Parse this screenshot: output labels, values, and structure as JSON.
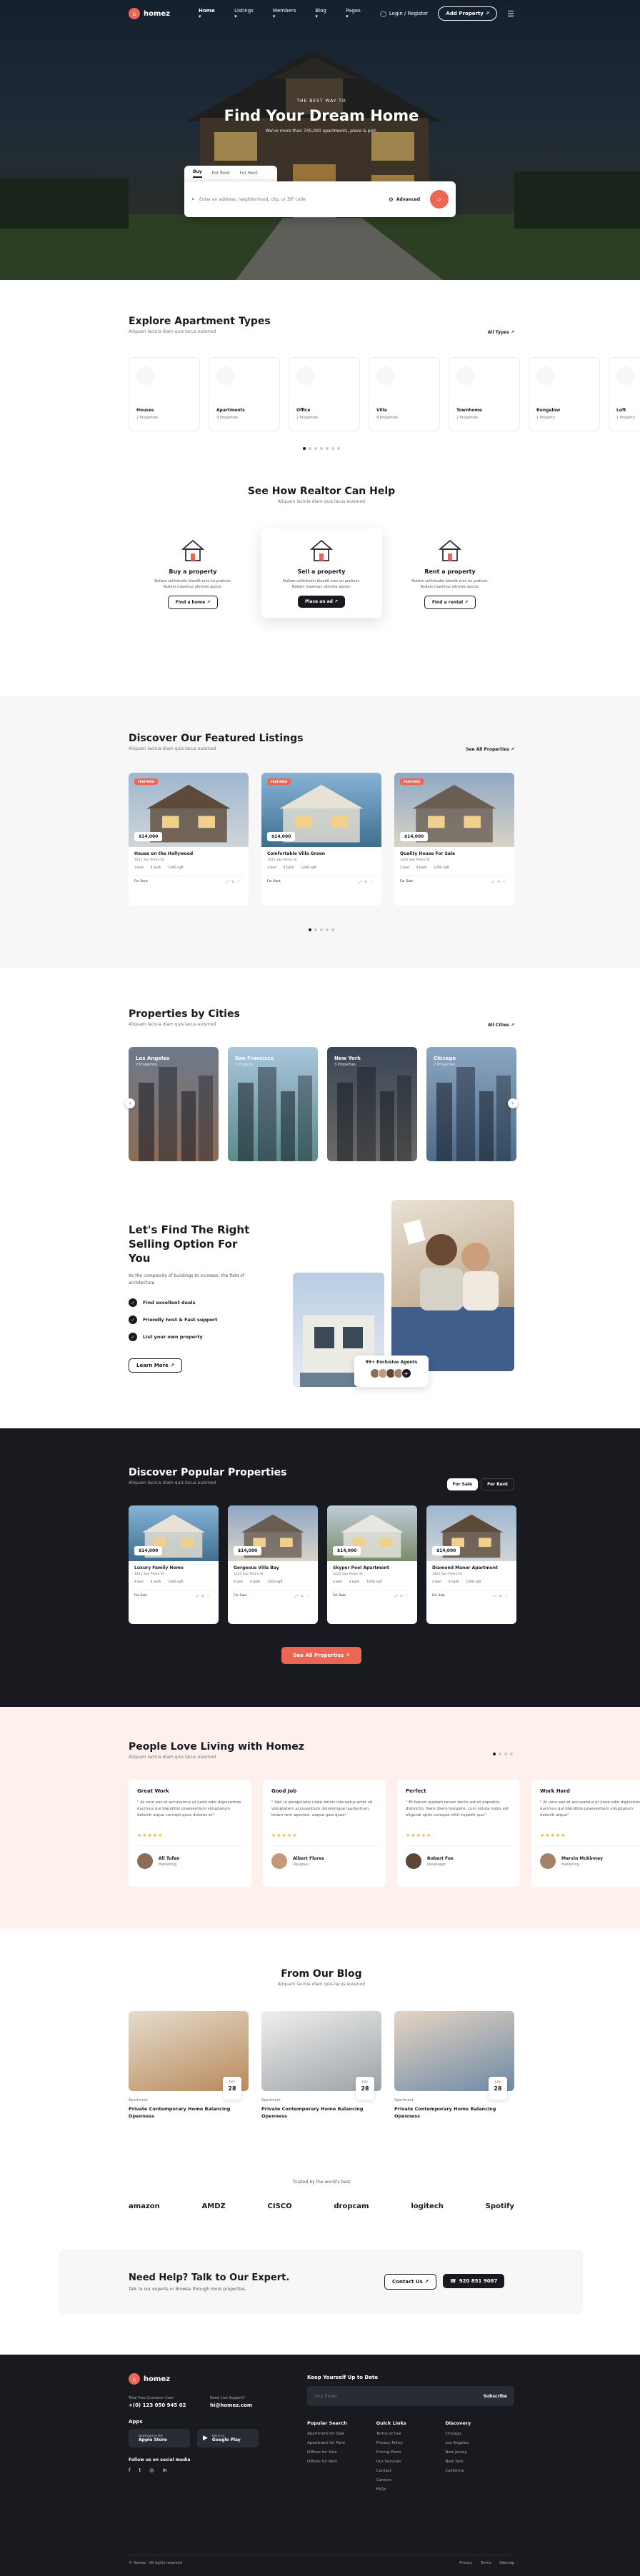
{
  "header": {
    "brand": "homez",
    "nav": [
      "Home ▾",
      "Listings ▾",
      "Members ▾",
      "Blog ▾",
      "Pages ▾"
    ],
    "login": "Login / Register",
    "add_property": "Add Property ↗"
  },
  "hero": {
    "kicker": "THE BEST WAY TO",
    "title": "Find Your Dream Home",
    "subtitle": "We've more than 745,000 apartments, place & plot.",
    "tabs": [
      "Buy",
      "For Rent",
      "For Rent"
    ],
    "search_placeholder": "Enter an address, neighborhood, city, or ZIP code",
    "advanced": "Advanced"
  },
  "types": {
    "title": "Explore Apartment Types",
    "subtitle": "Aliquam lacinia diam quis lacus euismod",
    "all": "All Types ↗",
    "items": [
      {
        "name": "Houses",
        "count": "2 Properties"
      },
      {
        "name": "Apartments",
        "count": "3 Properties"
      },
      {
        "name": "Office",
        "count": "2 Properties"
      },
      {
        "name": "Villa",
        "count": "4 Properties"
      },
      {
        "name": "Townhome",
        "count": "2 Properties"
      },
      {
        "name": "Bungalow",
        "count": "1 Property"
      },
      {
        "name": "Loft",
        "count": "1 Property"
      }
    ]
  },
  "help": {
    "title": "See How Realtor Can Help",
    "subtitle": "Aliquam lacinia diam quis lacus euismod",
    "items": [
      {
        "title": "Buy a property",
        "desc": "Nullam sollicitudin blandit eros eu pretium. Nullam maximus ultricies auctor.",
        "btn": "Find a home ↗"
      },
      {
        "title": "Sell a property",
        "desc": "Nullam sollicitudin blandit eros eu pretium. Nullam maximus ultricies auctor.",
        "btn": "Place an ad ↗"
      },
      {
        "title": "Rent a property",
        "desc": "Nullam sollicitudin blandit eros eu pretium. Nullam maximus ultricies auctor.",
        "btn": "Find a rental ↗"
      }
    ]
  },
  "featured": {
    "title": "Discover Our Featured Listings",
    "subtitle": "Aliquam lacinia diam quis lacus euismod",
    "all": "See All Properties ↗",
    "items": [
      {
        "tag": "FEATURED",
        "price": "$14,000",
        "name": "House on the Hollywood",
        "addr": "1421 San Pedro St",
        "beds": "3 bed",
        "baths": "4 bath",
        "sqft": "1200 sqft",
        "status": "For Rent"
      },
      {
        "tag": "FEATURED",
        "price": "$14,000",
        "name": "Comfortable Villa Green",
        "addr": "1421 San Pedro St",
        "beds": "3 bed",
        "baths": "4 bath",
        "sqft": "1200 sqft",
        "status": "For Rent"
      },
      {
        "tag": "FEATURED",
        "price": "$14,000",
        "name": "Quality House For Sale",
        "addr": "1421 San Pedro St",
        "beds": "3 bed",
        "baths": "4 bath",
        "sqft": "1200 sqft",
        "status": "For Sale"
      }
    ]
  },
  "cities": {
    "title": "Properties by Cities",
    "subtitle": "Aliquam lacinia diam quis lacus euismod",
    "all": "All Cities ↗",
    "items": [
      {
        "name": "Los Angeles",
        "count": "2 Properties"
      },
      {
        "name": "San Francisco",
        "count": "1 Property"
      },
      {
        "name": "New York",
        "count": "3 Properties"
      },
      {
        "name": "Chicago",
        "count": "2 Properties"
      }
    ]
  },
  "selling": {
    "title": "Let's Find The Right Selling Option For You",
    "desc": "As the complexity of buildings to increase, the field of architecture",
    "items": [
      "Find excellent deals",
      "Friendly host & Fast support",
      "List your own property"
    ],
    "btn": "Learn More ↗",
    "badge": "99+ Exclusive Agents"
  },
  "popular": {
    "title": "Discover Popular Properties",
    "subtitle": "Aliquam lacinia diam quis lacus euismod",
    "tabs": [
      "For Sale",
      "For Rent"
    ],
    "btn": "See All Properties ↗",
    "items": [
      {
        "price": "$14,000",
        "name": "Luxury Family Home",
        "addr": "1421 San Pedro St",
        "beds": "4 bed",
        "baths": "4 bath",
        "sqft": "1200 sqft",
        "status": "For Sale"
      },
      {
        "price": "$14,000",
        "name": "Gorgeous Villa Bay",
        "addr": "1421 San Pedro St",
        "beds": "4 bed",
        "baths": "4 bath",
        "sqft": "1200 sqft",
        "status": "For Sale"
      },
      {
        "price": "$14,000",
        "name": "Skyper Pool Apartment",
        "addr": "1421 San Pedro St",
        "beds": "4 bed",
        "baths": "4 bath",
        "sqft": "1200 sqft",
        "status": "For Sale"
      },
      {
        "price": "$14,000",
        "name": "Diamond Manor Apartment",
        "addr": "1421 San Pedro St",
        "beds": "4 bed",
        "baths": "4 bath",
        "sqft": "1200 sqft",
        "status": "For Sale"
      }
    ]
  },
  "testimonials": {
    "title": "People Love Living with Homez",
    "subtitle": "Aliquam lacinia diam quis lacus euismod",
    "items": [
      {
        "head": "Great Work",
        "text": "\" At vero eos et accusamus et iusto odio dignissimos ducimus qui blanditiis praesentium voluptatum deleniti atque corrupti quos dolores et\"",
        "name": "Ali Tufan",
        "role": "Marketing"
      },
      {
        "head": "Good Job",
        "text": "\" Sed ut perspiciatis unde omnis iste natus error sit voluptatem accusantium doloremque laudantium, totam rem aperiam, eaque ipsa quae\"",
        "name": "Albert Flores",
        "role": "Designer"
      },
      {
        "head": "Perfect",
        "text": "\" Et harum quidem rerum facilis est et expedita distinctio. Nam libero tempore, cum soluta nobis est eligendi optio cumque nihil impedit quo\"",
        "name": "Robert Fox",
        "role": "Developer"
      },
      {
        "head": "Work Hard",
        "text": "\" At vero eos et accusamus et iusto odio dignissimos ducimus qui blanditiis praesentium voluptatum deleniti atque\"",
        "name": "Marvin McKinney",
        "role": "Marketing"
      }
    ]
  },
  "blog": {
    "title": "From Our Blog",
    "subtitle": "Aliquam lacinia diam quis lacus euismod",
    "items": [
      {
        "cat": "Apartment",
        "month": "July",
        "day": "28",
        "title": "Private Contemporary Home Balancing Openness"
      },
      {
        "cat": "Apartment",
        "month": "July",
        "day": "28",
        "title": "Private Contemporary Home Balancing Openness"
      },
      {
        "cat": "Apartment",
        "month": "July",
        "day": "28",
        "title": "Private Contemporary Home Balancing Openness"
      }
    ]
  },
  "trusted": {
    "label": "Trusted by the world's best",
    "logos": [
      "amazon",
      "AMDZ",
      "CISCO",
      "dropcam",
      "logitech",
      "Spotify"
    ]
  },
  "help_cta": {
    "title": "Need Help? Talk to Our Expert.",
    "desc": "Talk to our experts or Browse through more properties.",
    "contact": "Contact Us ↗",
    "phone": "920 851 9087"
  },
  "footer": {
    "brand": "homez",
    "care_label": "Total Free Customer Care",
    "care": "+(0) 123 050 945 02",
    "support_label": "Need Live Support?",
    "support": "hi@homez.com",
    "apps_label": "Apps",
    "app1_small": "Download on the",
    "app1": "Apple Store",
    "app2_small": "Get it on",
    "app2": "Google Play",
    "social_label": "Follow us on social media",
    "keep_label": "Keep Yourself Up to Date",
    "email_placeholder": "Your Email",
    "subscribe": "Subscribe",
    "cols": [
      {
        "title": "Popular Search",
        "links": [
          "Apartment for Sale",
          "Apartment for Rent",
          "Offices for Sale",
          "Offices for Rent"
        ]
      },
      {
        "title": "Quick Links",
        "links": [
          "Terms of Use",
          "Privacy Policy",
          "Pricing Plans",
          "Our Services",
          "Contact",
          "Careers",
          "FAQs"
        ]
      },
      {
        "title": "Discovery",
        "links": [
          "Chicago",
          "Los Angeles",
          "New Jersey",
          "New York",
          "California"
        ]
      }
    ],
    "copyright": "© Homez - All rights reserved",
    "legal": [
      "Privacy",
      "Terms",
      "Sitemap"
    ]
  }
}
